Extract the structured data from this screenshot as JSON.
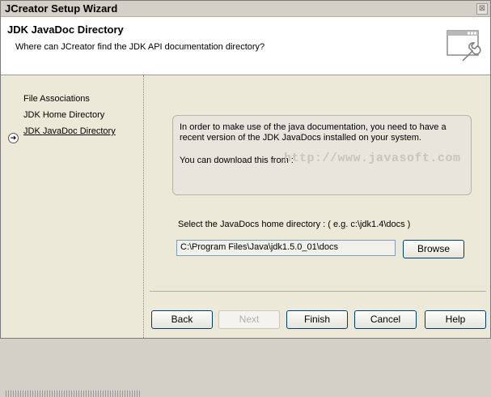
{
  "window": {
    "title": "JCreator Setup Wizard",
    "close_glyph": "⊠"
  },
  "header": {
    "title": "JDK JavaDoc Directory",
    "subtitle": "Where can JCreator find the JDK API documentation directory?",
    "icon": "window-wrench-icon"
  },
  "steps": [
    {
      "label": "File Associations",
      "active": false
    },
    {
      "label": "JDK Home Directory",
      "active": false
    },
    {
      "label": "JDK JavaDoc Directory",
      "active": true
    }
  ],
  "info": {
    "text": "In order to make use of the java documentation, you need to have a recent version of the JDK JavaDocs installed on your system.",
    "download_label": "You can download this from :",
    "download_link": "http://www.javasoft.com"
  },
  "select_label": "Select the JavaDocs home directory : ( e.g. c:\\jdk1.4\\docs )",
  "path_value": "C:\\Program Files\\Java\\jdk1.5.0_01\\docs",
  "buttons": {
    "browse": "Browse",
    "back": "Back",
    "next": "Next",
    "finish": "Finish",
    "cancel": "Cancel",
    "help": "Help"
  },
  "colors": {
    "link": "#c8c4bc",
    "field_border": "#7f9db9",
    "button_border": "#003c74"
  }
}
